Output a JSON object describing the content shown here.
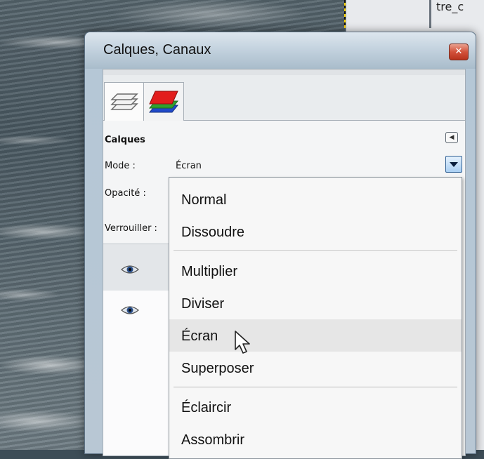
{
  "background": {
    "window_fragment": "tre_c"
  },
  "dialog": {
    "title": "Calques, Canaux",
    "close_glyph": "✕"
  },
  "tabs": [
    {
      "name": "layers-tab",
      "icon": "layers-stack-icon"
    },
    {
      "name": "channels-tab",
      "icon": "rgb-channels-icon"
    }
  ],
  "panel": {
    "title": "Calques",
    "mode_label": "Mode :",
    "mode_value": "Écran",
    "opacity_label": "Opacité :",
    "lock_label": "Verrouiller :"
  },
  "colors": {
    "channel_red": "#e21d1d",
    "channel_green": "#2fa12f",
    "channel_blue": "#2049c9"
  },
  "menu": {
    "items": [
      "Normal",
      "Dissoudre",
      "Multiplier",
      "Diviser",
      "Écran",
      "Superposer",
      "Éclaircir",
      "Assombrir"
    ],
    "hovered": "Écran"
  }
}
